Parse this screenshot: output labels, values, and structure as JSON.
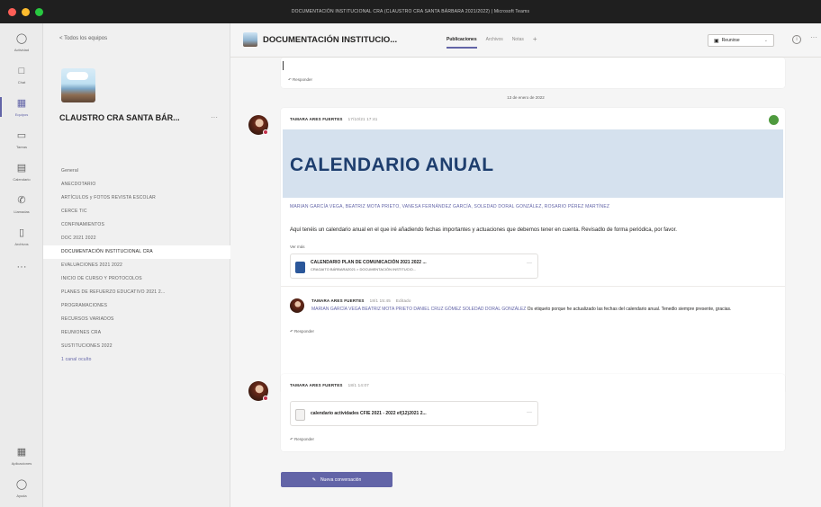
{
  "window": {
    "title": "DOCUMENTACIÓN INSTITUCIONAL CRA (CLAUSTRO CRA SANTA BÁRBARA 2021/2022) | Microsoft Teams",
    "traffic_colors": [
      "#ff5f57",
      "#febc2e",
      "#28c840"
    ]
  },
  "rail": {
    "items": [
      {
        "label": "Actividad",
        "icon": "bell-icon"
      },
      {
        "label": "Chat",
        "icon": "chat-icon"
      },
      {
        "label": "Equipos",
        "icon": "teams-icon"
      },
      {
        "label": "Tareas",
        "icon": "backpack-icon"
      },
      {
        "label": "Calendario",
        "icon": "calendar-icon"
      },
      {
        "label": "Llamadas",
        "icon": "phone-icon"
      },
      {
        "label": "Archivos",
        "icon": "file-icon"
      },
      {
        "label": "",
        "icon": "more-icon"
      },
      {
        "label": "Aplicaciones",
        "icon": "apps-icon"
      },
      {
        "label": "Ayuda",
        "icon": "help-icon"
      }
    ],
    "active_index": 2
  },
  "sidebar": {
    "back_label": "< Todos los equipos",
    "team_name": "CLAUSTRO CRA SANTA BÁR...",
    "team_more": "···",
    "channels": [
      "General",
      "ANECDOTARIO",
      "ARTÍCULOS y FOTOS REVISTA ESCOLAR",
      "CERCE TIC",
      "CONFINAMIENTOS",
      "DOC 2021 2022",
      "DOCUMENTACIÓN INSTITUCIONAL CRA",
      "EVALUACIONES 2021 2022",
      "INICIO DE CURSO Y PROTOCOLOS",
      "PLANES DE REFUERZO EDUCATIVO 2021 2...",
      "PROGRAMACIONES",
      "RECURSOS VARIADOS",
      "REUNIONES CRA",
      "SUSTITUCIONES 2022",
      "1 canal oculto"
    ],
    "selected_index": 6
  },
  "header": {
    "channel_title": "DOCUMENTACIÓN INSTITUCIO...",
    "tabs": [
      "Publicaciones",
      "Archivos",
      "Notas"
    ],
    "tab_add": "+",
    "meet_label": "Reunirse",
    "more": "···"
  },
  "feed": {
    "top_reply": "Responder",
    "date_separator": "13 de enero de 2022",
    "post1": {
      "author": "TAMARA ARES FUERTES",
      "time": "17/10/21 17:41",
      "banner_title": "CALENDARIO ANUAL",
      "mentions": "MARIAN GARCÍA VEGA, BEATRIZ MOTA PRIETO, VANESA FERNÁNDEZ GARCÍA, SOLEDAD DORAL GONZÁLEZ, ROSARIO PÉREZ MARTÍNEZ",
      "body": "Aquí tenéis un calendario anual en el que iré añadiendo fechas importantes y actuaciones que debemos tener en cuenta. Revisadlo de forma periódica, por favor.",
      "see_more": "Ver más",
      "file_name": "CALENDARIO PLAN DE COMUNICACIÓN 2021 2022 ...",
      "file_sub": "CRAGAITO BÁRBARA2021 > DOCUMENTACIÓN INSTITUCIO...",
      "file_more": "···",
      "reaction_color": "#4e9a3e"
    },
    "reply1": {
      "author": "TAMARA ARES FUERTES",
      "time": "18/1 15:45",
      "edited": "Editado",
      "mentions": "MARIAN GARCÍA VEGA BEATRIZ MOTA PRIETO DANIEL CRUZ GÓMEZ SOLEDAD DORAL GONZÁLEZ",
      "body_after": "Os etiqueto porque he actualizado las fechas del calendario anual. Tenedlo siempre presente, gracias.",
      "reply_label": "Responder"
    },
    "post2": {
      "author": "TAMARA ARES FUERTES",
      "time": "18/1 14:07",
      "file_name": "calendario actividades CFIE 2021 - 2022 ef(12)2021 2...",
      "file_more": "···",
      "reply_label": "Responder"
    },
    "new_conversation": "Nueva conversación"
  },
  "colors": {
    "accent": "#6264a7",
    "banner_bg": "#d5e1ee",
    "banner_text": "#1e3e6e",
    "presence_busy": "#c4314b"
  }
}
